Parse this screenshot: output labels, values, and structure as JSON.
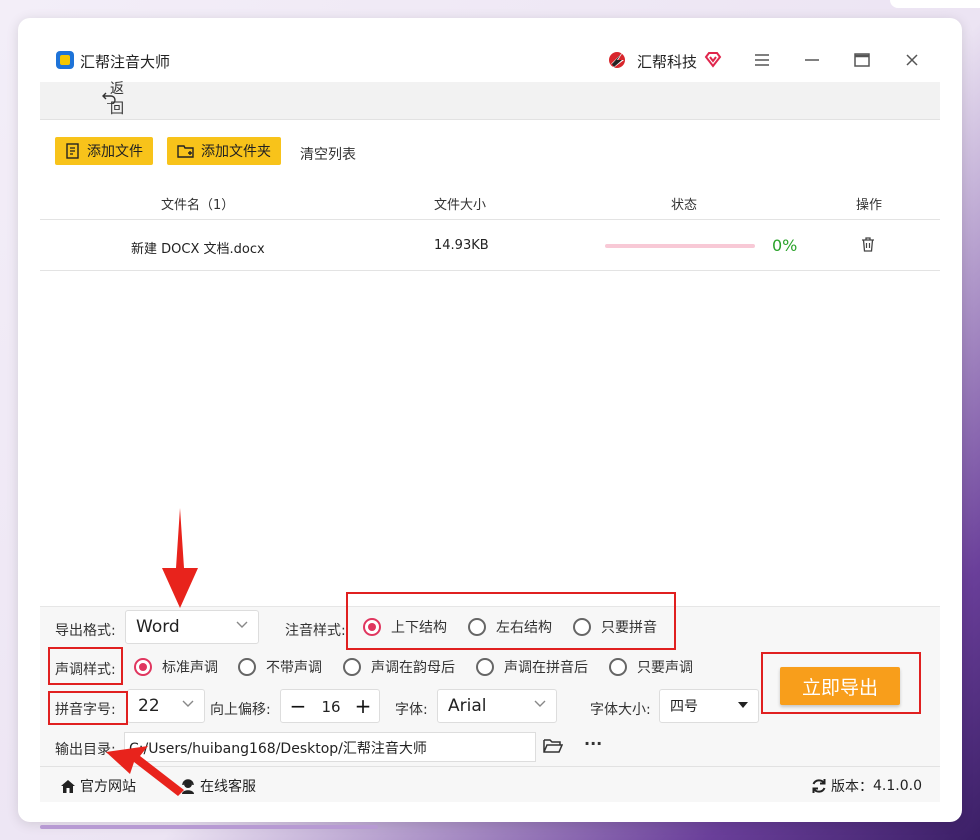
{
  "app": {
    "title": "汇帮注音大师",
    "brand": "汇帮科技",
    "back_label": "返回"
  },
  "toolbar": {
    "add_file": "添加文件",
    "add_folder": "添加文件夹",
    "clear_list": "清空列表"
  },
  "table": {
    "headers": {
      "name": "文件名（1）",
      "size": "文件大小",
      "status": "状态",
      "action": "操作"
    },
    "rows": [
      {
        "name": "新建 DOCX 文档.docx",
        "size": "14.93KB",
        "progress": 0,
        "progress_label": "0%"
      }
    ]
  },
  "options": {
    "export_format_label": "导出格式:",
    "export_format_value": "Word",
    "annotation_style_label": "注音样式:",
    "annotation_styles": [
      "上下结构",
      "左右结构",
      "只要拼音"
    ],
    "annotation_selected": "上下结构",
    "tone_style_label": "声调样式:",
    "tone_styles": [
      "标准声调",
      "不带声调",
      "声调在韵母后",
      "声调在拼音后",
      "只要声调"
    ],
    "tone_selected": "标准声调",
    "pinyin_size_label": "拼音字号:",
    "pinyin_size_value": "22",
    "offset_label": "向上偏移:",
    "offset_value": "16",
    "font_label": "字体:",
    "font_value": "Arial",
    "font_size_label": "字体大小:",
    "font_size_value": "四号",
    "output_dir_label": "输出目录:",
    "output_dir_value": "C:/Users/huibang168/Desktop/汇帮注音大师",
    "more_label": "···"
  },
  "export_button": "立即导出",
  "footer": {
    "website": "官方网站",
    "support": "在线客服",
    "version_label": "版本：",
    "version": "4.1.0.0"
  },
  "colors": {
    "accent_yellow": "#f8c31a",
    "export_orange": "#f89e1b",
    "radio_active": "#e0365f",
    "progress_pink": "#f8c9d6",
    "annotation_red": "#e02020",
    "percent_green": "#2ba22b"
  }
}
